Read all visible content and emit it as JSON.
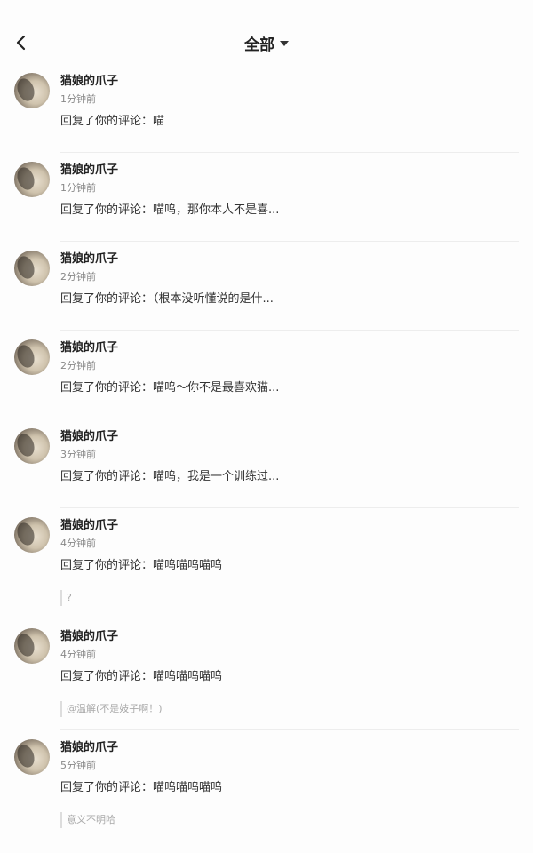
{
  "header": {
    "title": "全部"
  },
  "notifications": [
    {
      "name": "猫娘的爪子",
      "time": "1分钟前",
      "reply": "回复了你的评论：喵",
      "quote": ""
    },
    {
      "name": "猫娘的爪子",
      "time": "1分钟前",
      "reply": "回复了你的评论：喵呜，那你本人不是喜...",
      "quote": ""
    },
    {
      "name": "猫娘的爪子",
      "time": "2分钟前",
      "reply": "回复了你的评论：（根本没听懂说的是什...",
      "quote": ""
    },
    {
      "name": "猫娘的爪子",
      "time": "2分钟前",
      "reply": "回复了你的评论：喵呜～你不是最喜欢猫...",
      "quote": ""
    },
    {
      "name": "猫娘的爪子",
      "time": "3分钟前",
      "reply": "回复了你的评论：喵呜，我是一个训练过...",
      "quote": ""
    },
    {
      "name": "猫娘的爪子",
      "time": "4分钟前",
      "reply": "回复了你的评论：喵呜喵呜喵呜",
      "quote": "?"
    },
    {
      "name": "猫娘的爪子",
      "time": "4分钟前",
      "reply": "回复了你的评论：喵呜喵呜喵呜",
      "quote": "@温解(不是妓子啊！)"
    },
    {
      "name": "猫娘的爪子",
      "time": "5分钟前",
      "reply": "回复了你的评论：喵呜喵呜喵呜",
      "quote": "意义不明哈"
    }
  ]
}
